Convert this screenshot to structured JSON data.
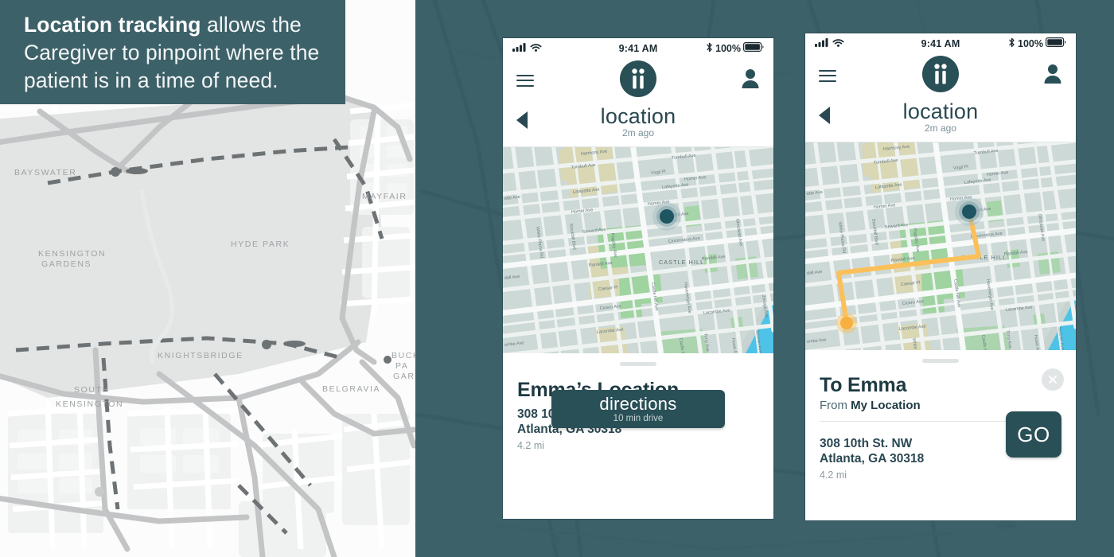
{
  "caption": {
    "bold": "Location tracking",
    "rest": " allows the Caregiver to pinpoint where the patient is in a time of need."
  },
  "colors": {
    "backdrop_teal": "#3d6169",
    "brand_dark_teal": "#2a5057",
    "title_teal": "#2a4851",
    "map_land": "#cdd9d6",
    "map_road": "#f2f6f5",
    "map_park_green": "#9fd3a0",
    "map_sand": "#d9d7b4",
    "map_water": "#4ec3e8",
    "route_orange": "#fbc05a",
    "marker_teal": "#1d5560",
    "marker_halo": "#9fb9bd"
  },
  "left_map": {
    "labels": [
      "BAYSWATER",
      "MAYFAIR",
      "HYDE PARK",
      "KENSINGTON GARDENS",
      "KNIGHTSBRIDGE",
      "SOUTH KENSINGTON",
      "BELGRAVIA",
      "BUCKINGHAM PALACE GARDENS"
    ]
  },
  "phones": [
    {
      "id": "phone-location",
      "statusbar": {
        "time": "9:41 AM",
        "battery_pct": "100%",
        "signal_icon": "cellular-signal-icon",
        "wifi_icon": "wifi-icon",
        "bluetooth_icon": "bluetooth-icon",
        "battery_icon": "battery-full-icon"
      },
      "appbar": {
        "menu_icon": "hamburger-menu-icon",
        "logo_icon": "app-logo-icon",
        "profile_icon": "user-profile-icon"
      },
      "title": "location",
      "subtitle": "2m ago",
      "back_icon": "back-arrow-icon",
      "card": {
        "heading": "Emma’s Location",
        "address_line1": "308 10th St. NW",
        "address_line2": "Atlanta, GA 30318",
        "distance": "4.2 mi",
        "button_label": "directions",
        "button_sub": "10 min drive"
      },
      "map": {
        "streets": [
          "Harmony Ave",
          "Turnbull Ave",
          "Lafayette Ave",
          "Virgil Pl",
          "Homer Ave",
          "Seward Ave",
          "Cincinnatus Ave",
          "Randall Ave",
          "Caesar Pl",
          "Cicero Ave",
          "Lacombe Ave",
          "White Plains Rd",
          "Stockbill Blvd",
          "Pugsley Ave",
          "Olmstead Ave",
          "Castle Hill Ave",
          "Havemeyer Ave",
          "Torry Ave",
          "Howe Ave",
          "Screvin Ave",
          "Zerega Ave"
        ],
        "neighborhood": "CASTLE HILL",
        "marker": "destination-marker"
      }
    },
    {
      "id": "phone-directions",
      "statusbar": {
        "time": "9:41 AM",
        "battery_pct": "100%",
        "signal_icon": "cellular-signal-icon",
        "wifi_icon": "wifi-icon",
        "bluetooth_icon": "bluetooth-icon",
        "battery_icon": "battery-full-icon"
      },
      "appbar": {
        "menu_icon": "hamburger-menu-icon",
        "logo_icon": "app-logo-icon",
        "profile_icon": "user-profile-icon"
      },
      "title": "location",
      "subtitle": "2m ago",
      "back_icon": "back-arrow-icon",
      "card": {
        "heading": "To Emma",
        "from_prefix": "From ",
        "from_value": "My Location",
        "address_line1": "308 10th St. NW",
        "address_line2": "Atlanta, GA 30318",
        "distance": "4.2 mi",
        "go_label": "GO",
        "close_icon": "close-circle-icon"
      },
      "map": {
        "streets": [
          "Harmony Ave",
          "Turnbull Ave",
          "Lafayette Ave",
          "Virgil Pl",
          "Homer Ave",
          "Seward Ave",
          "Cincinnatus Ave",
          "Randall Ave",
          "Caesar Pl",
          "Cicero Ave",
          "Lacombe Ave",
          "White Plains Rd",
          "Stockbill Blvd",
          "Pugsley Ave",
          "Olmstead Ave",
          "Castle Hill Ave",
          "Havemeyer Ave",
          "Torry Ave",
          "Howe Ave",
          "Screvin Ave"
        ],
        "neighborhood": "CASTLE HILL",
        "markers": [
          "destination-marker",
          "origin-marker"
        ],
        "route": "route-polyline"
      }
    }
  ]
}
